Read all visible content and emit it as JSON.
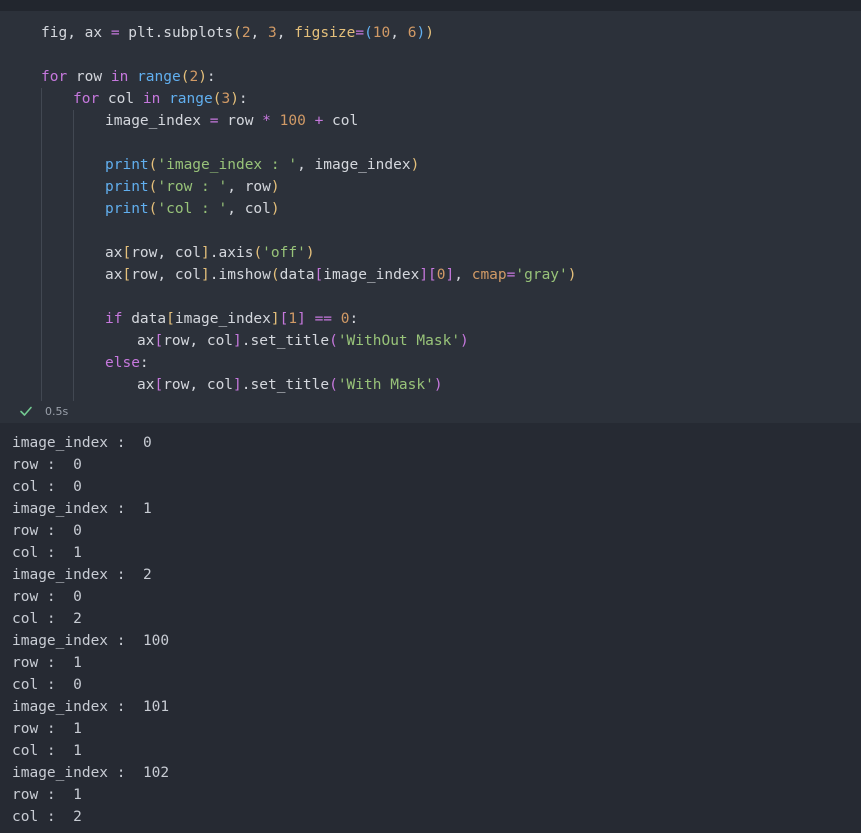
{
  "code": {
    "line1": {
      "a": "fig, ax ",
      "b": "=",
      "c": " plt.subplots",
      "d": "(",
      "e": "2",
      "f": ", ",
      "g": "3",
      "h": ", ",
      "i": "figsize",
      "j": "=",
      "k": "(",
      "l": "10",
      "m": ", ",
      "n": "6",
      "o": ")",
      "p": ")"
    },
    "line2": {
      "kw_for": "for",
      "a": " row ",
      "kw_in": "in",
      "sp": " ",
      "fn": "range",
      "p1": "(",
      "num": "2",
      "p2": ")",
      "colon": ":"
    },
    "line3": {
      "kw_for": "for",
      "a": " col ",
      "kw_in": "in",
      "sp": " ",
      "fn": "range",
      "p1": "(",
      "num": "3",
      "p2": ")",
      "colon": ":"
    },
    "line4": {
      "a": "image_index ",
      "eq": "=",
      "b": " row ",
      "mul": "*",
      "sp": " ",
      "num": "100",
      "sp2": " ",
      "plus": "+",
      "c": " col"
    },
    "line5": {
      "fn": "print",
      "p1": "(",
      "str": "'image_index : '",
      "a": ", image_index",
      "p2": ")"
    },
    "line6": {
      "fn": "print",
      "p1": "(",
      "str": "'row : '",
      "a": ", row",
      "p2": ")"
    },
    "line7": {
      "fn": "print",
      "p1": "(",
      "str": "'col : '",
      "a": ", col",
      "p2": ")"
    },
    "line8": {
      "a": "ax",
      "b1": "[",
      "b": "row, col",
      "b2": "]",
      "c": ".axis",
      "p1": "(",
      "str": "'off'",
      "p2": ")"
    },
    "line9": {
      "a": "ax",
      "b1": "[",
      "b": "row, col",
      "b2": "]",
      "c": ".imshow",
      "p1": "(",
      "d": "data",
      "q1": "[",
      "e": "image_index",
      "q2": "]",
      "q3": "[",
      "num": "0",
      "q4": "]",
      "f": ", ",
      "param": "cmap",
      "eq": "=",
      "str": "'gray'",
      "p2": ")"
    },
    "line10": {
      "kw_if": "if",
      "a": " data",
      "q1": "[",
      "b": "image_index",
      "q2": "]",
      "q3": "[",
      "num1": "1",
      "q4": "]",
      "sp": " ",
      "op": "==",
      "sp2": " ",
      "num2": "0",
      "colon": ":"
    },
    "line11": {
      "a": "ax",
      "b1": "[",
      "b": "row, col",
      "b2": "]",
      "c": ".set_title",
      "p1": "(",
      "str": "'WithOut Mask'",
      "p2": ")"
    },
    "line12": {
      "kw_else": "else",
      "colon": ":"
    },
    "line13": {
      "a": "ax",
      "b1": "[",
      "b": "row, col",
      "b2": "]",
      "c": ".set_title",
      "p1": "(",
      "str": "'With Mask'",
      "p2": ")"
    }
  },
  "status": {
    "icon": "check-icon",
    "elapsed": "0.5s",
    "color": "#73c991"
  },
  "output": {
    "lines": [
      "image_index :  0",
      "row :  0",
      "col :  0",
      "image_index :  1",
      "row :  0",
      "col :  1",
      "image_index :  2",
      "row :  0",
      "col :  2",
      "image_index :  100",
      "row :  1",
      "col :  0",
      "image_index :  101",
      "row :  1",
      "col :  1",
      "image_index :  102",
      "row :  1",
      "col :  2"
    ]
  }
}
